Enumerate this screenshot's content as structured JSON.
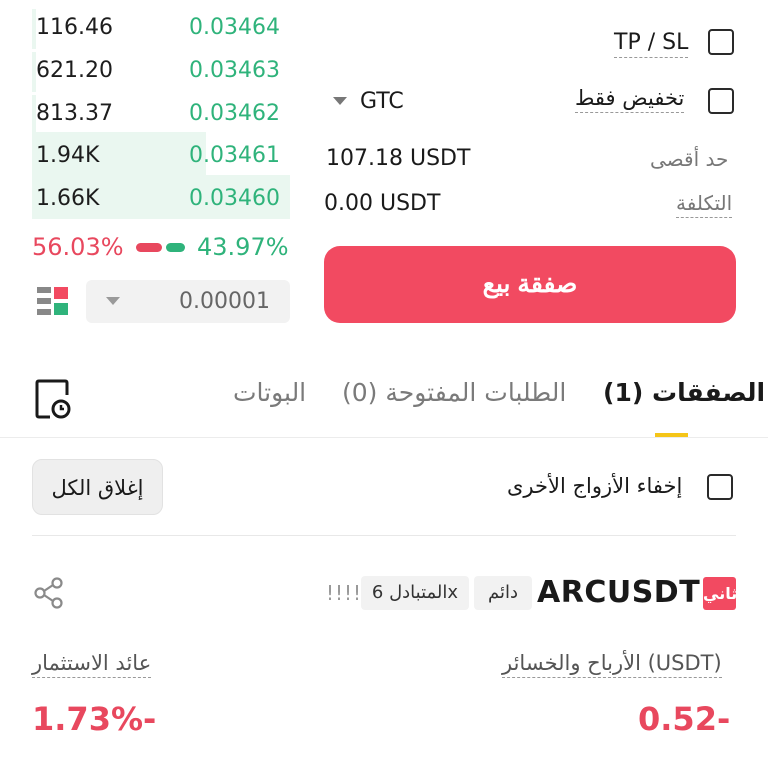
{
  "order_book": {
    "rows": [
      {
        "qty": "116.46",
        "price": "0.03464",
        "depth": 0.02
      },
      {
        "qty": "621.20",
        "price": "0.03463",
        "depth": 0.02
      },
      {
        "qty": "813.37",
        "price": "0.03462",
        "depth": 0.02
      },
      {
        "qty": "1.94K",
        "price": "0.03461",
        "depth": 0.68
      },
      {
        "qty": "1.66K",
        "price": "0.03460",
        "depth": 1.0
      }
    ],
    "sell_ratio": "56.03%",
    "buy_ratio": "43.97%",
    "precision": "0.00001",
    "layout_icon": "orderbook-layout-icon"
  },
  "form": {
    "tpsl_label": "TP / SL",
    "reduce_only_label": "تخفيض فقط",
    "time_in_force": "GTC",
    "max_label": "حد أقصى",
    "max_value": "107.18 USDT",
    "cost_label": "التكلفة",
    "cost_value": "0.00 USDT",
    "sell_button": "صفقة بيع"
  },
  "tabs": {
    "positions": "الصفقات (1)",
    "open_orders": "الطلبات المفتوحة (0)",
    "bots": "البوتات",
    "history_icon": "history-icon"
  },
  "filters": {
    "hide_other_pairs": "إخفاء الأزواج الأخرى",
    "close_all": "إغلاق الكل"
  },
  "position": {
    "side_badge": "ثاني",
    "symbol": "ARCUSDT",
    "type_tag": "دائم",
    "margin_tag": "المتبادل 6x",
    "signal": "!!!!",
    "pnl_label": "الأرباح والخسائر (USDT)",
    "pnl_value": "0.52-",
    "roi_label": "عائد الاستثمار",
    "roi_value": "1.73%-",
    "share_icon": "share-icon"
  },
  "colors": {
    "accent_red": "#f24a61",
    "accent_green": "#2fb37b",
    "tab_indicator": "#f5c518"
  }
}
